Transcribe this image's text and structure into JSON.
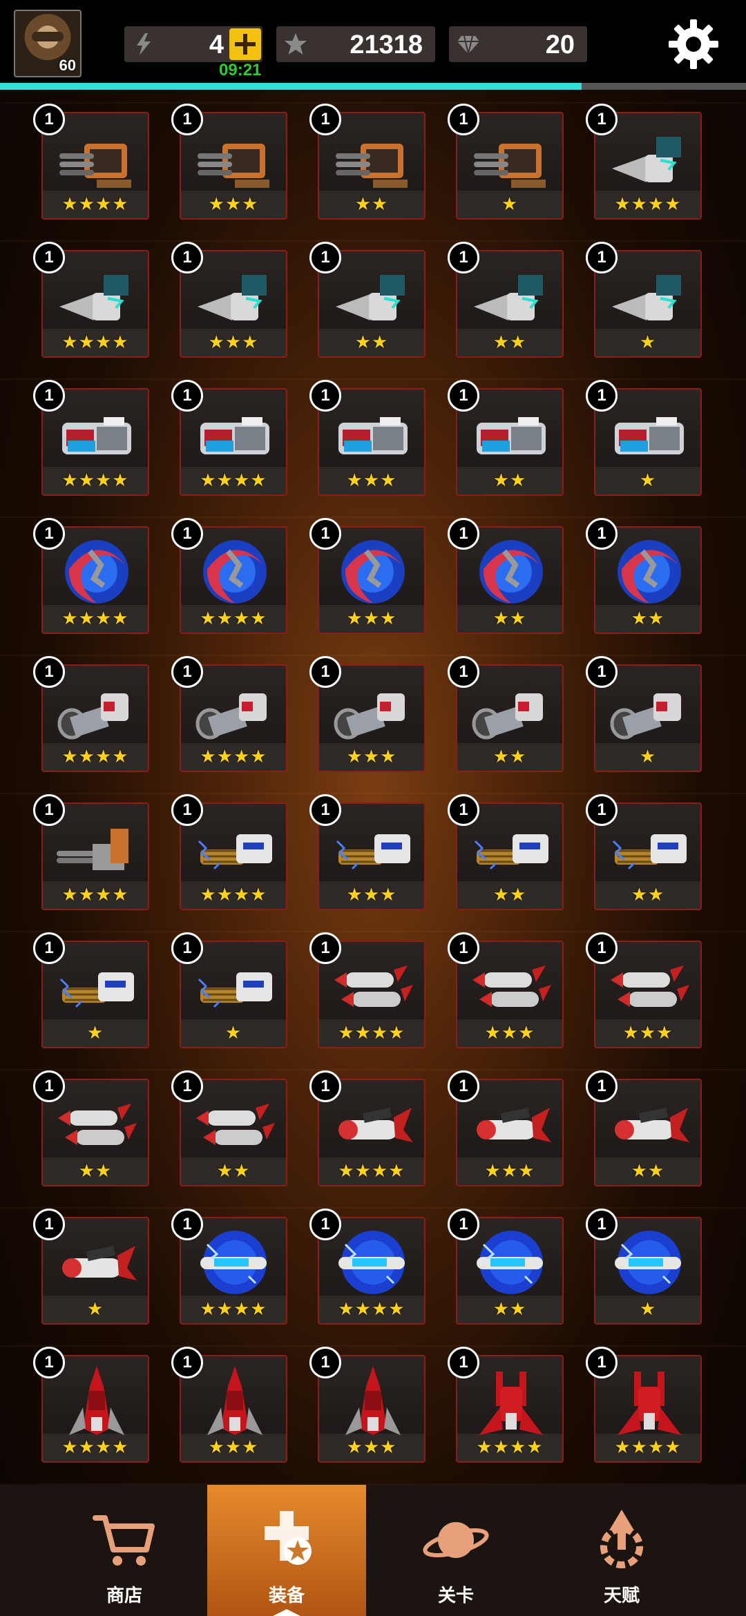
{
  "header": {
    "player_level": "60",
    "energy": "4",
    "energy_timer": "09:21",
    "stars": "21318",
    "gems": "20",
    "progress_fraction": 0.78
  },
  "grid": {
    "rows": [
      [
        {
          "count": "1",
          "stars": "★★★★",
          "item": "gatling-turret"
        },
        {
          "count": "1",
          "stars": "★★★",
          "item": "gatling-turret"
        },
        {
          "count": "1",
          "stars": "★★",
          "item": "gatling-turret"
        },
        {
          "count": "1",
          "stars": "★",
          "item": "gatling-turret"
        },
        {
          "count": "1",
          "stars": "★★★★",
          "item": "drill-cannon"
        }
      ],
      [
        {
          "count": "1",
          "stars": "★★★★",
          "item": "drill-cannon"
        },
        {
          "count": "1",
          "stars": "★★★",
          "item": "drill-cannon"
        },
        {
          "count": "1",
          "stars": "★★",
          "item": "drill-cannon"
        },
        {
          "count": "1",
          "stars": "★★",
          "item": "drill-cannon"
        },
        {
          "count": "1",
          "stars": "★",
          "item": "drill-cannon"
        }
      ],
      [
        {
          "count": "1",
          "stars": "★★★★",
          "item": "laser-battery"
        },
        {
          "count": "1",
          "stars": "★★★★",
          "item": "laser-battery"
        },
        {
          "count": "1",
          "stars": "★★★",
          "item": "laser-battery"
        },
        {
          "count": "1",
          "stars": "★★",
          "item": "laser-battery"
        },
        {
          "count": "1",
          "stars": "★",
          "item": "laser-battery"
        }
      ],
      [
        {
          "count": "1",
          "stars": "★★★★",
          "item": "energy-blade"
        },
        {
          "count": "1",
          "stars": "★★★★",
          "item": "energy-blade"
        },
        {
          "count": "1",
          "stars": "★★★",
          "item": "energy-blade"
        },
        {
          "count": "1",
          "stars": "★★",
          "item": "energy-blade"
        },
        {
          "count": "1",
          "stars": "★★",
          "item": "energy-blade"
        }
      ],
      [
        {
          "count": "1",
          "stars": "★★★★",
          "item": "plasma-cannon"
        },
        {
          "count": "1",
          "stars": "★★★★",
          "item": "plasma-cannon"
        },
        {
          "count": "1",
          "stars": "★★★",
          "item": "plasma-cannon"
        },
        {
          "count": "1",
          "stars": "★★",
          "item": "plasma-cannon"
        },
        {
          "count": "1",
          "stars": "★",
          "item": "plasma-cannon"
        }
      ],
      [
        {
          "count": "1",
          "stars": "★★★★",
          "item": "gatling-gun"
        },
        {
          "count": "1",
          "stars": "★★★★",
          "item": "tesla-rifle"
        },
        {
          "count": "1",
          "stars": "★★★",
          "item": "tesla-rifle"
        },
        {
          "count": "1",
          "stars": "★★",
          "item": "tesla-rifle"
        },
        {
          "count": "1",
          "stars": "★★",
          "item": "tesla-rifle"
        }
      ],
      [
        {
          "count": "1",
          "stars": "★",
          "item": "tesla-rifle"
        },
        {
          "count": "1",
          "stars": "★",
          "item": "tesla-rifle"
        },
        {
          "count": "1",
          "stars": "★★★★",
          "item": "twin-missile"
        },
        {
          "count": "1",
          "stars": "★★★",
          "item": "twin-missile"
        },
        {
          "count": "1",
          "stars": "★★★",
          "item": "twin-missile"
        }
      ],
      [
        {
          "count": "1",
          "stars": "★★",
          "item": "twin-missile"
        },
        {
          "count": "1",
          "stars": "★★",
          "item": "twin-missile"
        },
        {
          "count": "1",
          "stars": "★★★★",
          "item": "missile"
        },
        {
          "count": "1",
          "stars": "★★★",
          "item": "missile"
        },
        {
          "count": "1",
          "stars": "★★",
          "item": "missile"
        }
      ],
      [
        {
          "count": "1",
          "stars": "★",
          "item": "missile"
        },
        {
          "count": "1",
          "stars": "★★★★",
          "item": "emp-missile"
        },
        {
          "count": "1",
          "stars": "★★★★",
          "item": "emp-missile"
        },
        {
          "count": "1",
          "stars": "★★",
          "item": "emp-missile"
        },
        {
          "count": "1",
          "stars": "★",
          "item": "emp-missile"
        }
      ],
      [
        {
          "count": "1",
          "stars": "★★★★",
          "item": "red-fighter"
        },
        {
          "count": "1",
          "stars": "★★★",
          "item": "red-fighter"
        },
        {
          "count": "1",
          "stars": "★★★",
          "item": "red-fighter"
        },
        {
          "count": "1",
          "stars": "★★★★",
          "item": "red-twin-fighter"
        },
        {
          "count": "1",
          "stars": "★★★★",
          "item": "red-twin-fighter"
        }
      ]
    ]
  },
  "nav": {
    "items": [
      {
        "label": "商店",
        "icon": "cart-icon"
      },
      {
        "label": "装备",
        "icon": "equipment-icon",
        "active": true
      },
      {
        "label": "关卡",
        "icon": "planet-icon"
      },
      {
        "label": "天赋",
        "icon": "talent-icon"
      }
    ]
  },
  "colors": {
    "accent": "#2ee0d6",
    "timer": "#2ecc2e",
    "star": "#ffd21a",
    "card_border": "#8c1e16",
    "nav_active": "#e68a2d"
  }
}
